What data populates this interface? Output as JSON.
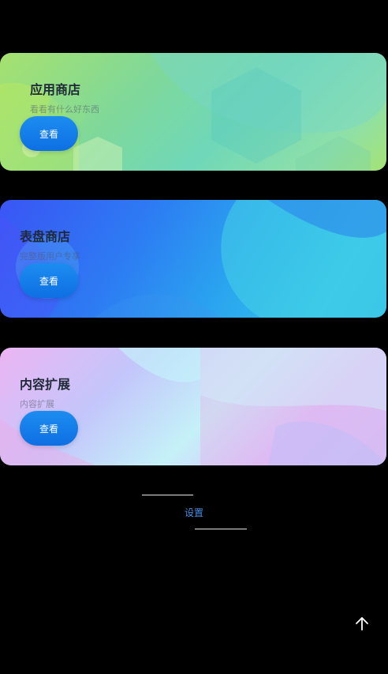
{
  "cards": [
    {
      "title": "应用商店",
      "subtitle": "看看有什么好东西",
      "button_label": "查看"
    },
    {
      "title": "表盘商店",
      "subtitle": "完整版用户专享",
      "button_label": "查看"
    },
    {
      "title": "内容扩展",
      "subtitle": "内容扩展",
      "button_label": "查看"
    }
  ],
  "settings": {
    "label": "设置"
  },
  "icons": {
    "back_to_top": "arrow-up-icon"
  },
  "colors": {
    "background": "#000000",
    "button": "#1c8df0",
    "settings_text": "#4a8ee6"
  }
}
